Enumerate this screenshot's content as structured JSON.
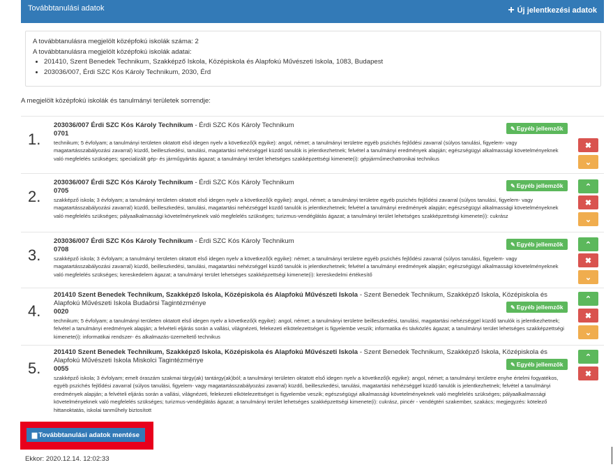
{
  "header": {
    "title": "Továbbtanulási adatok",
    "new_button": "Új jelentkezési adatok"
  },
  "info": {
    "line1": "A továbbtanulásra megjelölt középfokú iskolák száma: 2",
    "line2": "A továbbtanulásra megjelölt középfokú iskolák adatai:",
    "schools": [
      "201410, Szent Benedek Technikum, Szakképző Iskola, Középiskola és Alapfokú Művészeti Iskola, 1083, Budapest",
      "203036/007, Érdi SZC Kós Károly Technikum, 2030, Érd"
    ]
  },
  "order_title": "A megjelölt középfokú iskolák és tanulmányi területek sorrendje:",
  "rows": [
    {
      "num": "1.",
      "school_bold": "203036/007 Érdi SZC Kós Károly Technikum",
      "school_rest": " - Érdi SZC Kós Károly Technikum",
      "code": "0701",
      "desc": "technikum; 5 évfolyam; a tanulmányi területen oktatott első idegen nyelv a következő(k egyike): angol, német; a tanulmányi területre egyéb pszichés fejlődési zavarral (súlyos tanulási, figyelem- vagy magatartásszabályozási zavarral) küzdő, beilleszkedési, tanulási, magatartási nehézséggel küzdő tanulók is jelentkezhetnek; felvétel a tanulmányi eredmények alapján; egészségügyi alkalmassági követelményeknek való megfelelés szükséges; specializált gép- és járműgyártás ágazat; a tanulmányi terület lehetséges szakképzettségi kimenete(i): gépjárműmechatronikai technikus",
      "button": "Egyéb jellemzők"
    },
    {
      "num": "2.",
      "school_bold": "203036/007 Érdi SZC Kós Károly Technikum",
      "school_rest": " - Érdi SZC Kós Károly Technikum",
      "code": "0705",
      "desc": "szakképző iskola; 3 évfolyam; a tanulmányi területen oktatott első idegen nyelv a következő(k egyike): angol, német; a tanulmányi területre egyéb pszichés fejlődési zavarral (súlyos tanulási, figyelem- vagy magatartásszabályozási zavarral) küzdő, beilleszkedési, tanulási, magatartási nehézséggel küzdő tanulók is jelentkezhetnek; felvétel a tanulmányi eredmények alapján; egészségügyi alkalmassági követelményeknek való megfelelés szükséges; pályaalkalmassági követelményeknek való megfelelés szükséges; turizmus-vendéglátás ágazat; a tanulmányi terület lehetséges szakképzettségi kimenete(i): cukrász",
      "button": "Egyéb jellemzők"
    },
    {
      "num": "3.",
      "school_bold": "203036/007 Érdi SZC Kós Károly Technikum",
      "school_rest": " - Érdi SZC Kós Károly Technikum",
      "code": "0708",
      "desc": "szakképző iskola; 3 évfolyam; a tanulmányi területen oktatott első idegen nyelv a következő(k egyike): német; a tanulmányi területre egyéb pszichés fejlődési zavarral (súlyos tanulási, figyelem- vagy magatartásszabályozási zavarral) küzdő, beilleszkedési, tanulási, magatartási nehézséggel küzdő tanulók is jelentkezhetnek; felvétel a tanulmányi eredmények alapján; egészségügyi alkalmassági követelményeknek való megfelelés szükséges; kereskedelem ágazat; a tanulmányi terület lehetséges szakképzettségi kimenete(i): kereskedelmi értékesítő",
      "button": "Egyéb jellemzők"
    },
    {
      "num": "4.",
      "school_bold": "201410 Szent Benedek Technikum, Szakképző Iskola, Középiskola és Alapfokú Művészeti Iskola",
      "school_rest": " - Szent Benedek Technikum, Szakképző Iskola, Középiskola és Alapfokú Művészeti Iskola Budaörsi Tagintézménye",
      "code": "0020",
      "desc": "technikum; 5 évfolyam; a tanulmányi területen oktatott első idegen nyelv a következő(k egyike): angol, német; a tanulmányi területre beilleszkedési, tanulási, magatartási nehézséggel küzdő tanulók is jelentkezhetnek; felvétel a tanulmányi eredmények alapján; a felvételi eljárás során a vallási, világnézeti, felekezeti elkötelezettséget is figyelembe veszik; informatika és távközlés ágazat; a tanulmányi terület lehetséges szakképzettségi kimenete(i): informatikai rendszer- és alkalmazás-üzemeltető technikus",
      "button": "Egyéb jellemzők"
    },
    {
      "num": "5.",
      "school_bold": "201410 Szent Benedek Technikum, Szakképző Iskola, Középiskola és Alapfokú Művészeti Iskola",
      "school_rest": " - Szent Benedek Technikum, Szakképző Iskola, Középiskola és Alapfokú Művészeti Iskola Miskolci Tagintézménye",
      "code": "0055",
      "desc": "szakképző iskola; 3 évfolyam; emelt óraszám szakmai tárgy(ak) tantárgy(ak)ból; a tanulmányi területen oktatott első idegen nyelv a következő(k egyike): angol, német; a tanulmányi területre enyhe értelmi fogyatékos, egyéb pszichés fejlődési zavarral (súlyos tanulási, figyelem- vagy magatartásszabályozási zavarral) küzdő, beilleszkedési, tanulási, magatartási nehézséggel küzdő tanulók is jelentkezhetnek; felvétel a tanulmányi eredmények alapján; a felvételi eljárás során a vallási, világnézeti, felekezeti elkötelezettséget is figyelembe veszik; egészségügyi alkalmassági követelményeknek való megfelelés szükséges; pályaalkalmassági követelményeknek való megfelelés szükséges; turizmus-vendéglátás ágazat; a tanulmányi terület lehetséges szakképzettségi kimenete(i): cukrász, pincér - vendégtéri szakember, szakács; megjegyzés: kötelező hittanoktatás, iskolai tanműhely biztosított",
      "button": "Egyéb jellemzők"
    }
  ],
  "save_button": "Továbbtanulási adatok mentése",
  "ekkor": "Ekkor: 2020.12.14. 12:02:33",
  "colors": {
    "primary": "#337ab7",
    "success": "#5cb85c",
    "danger": "#d9534f",
    "warning": "#f0ad4e",
    "highlight": "#e8001c"
  }
}
